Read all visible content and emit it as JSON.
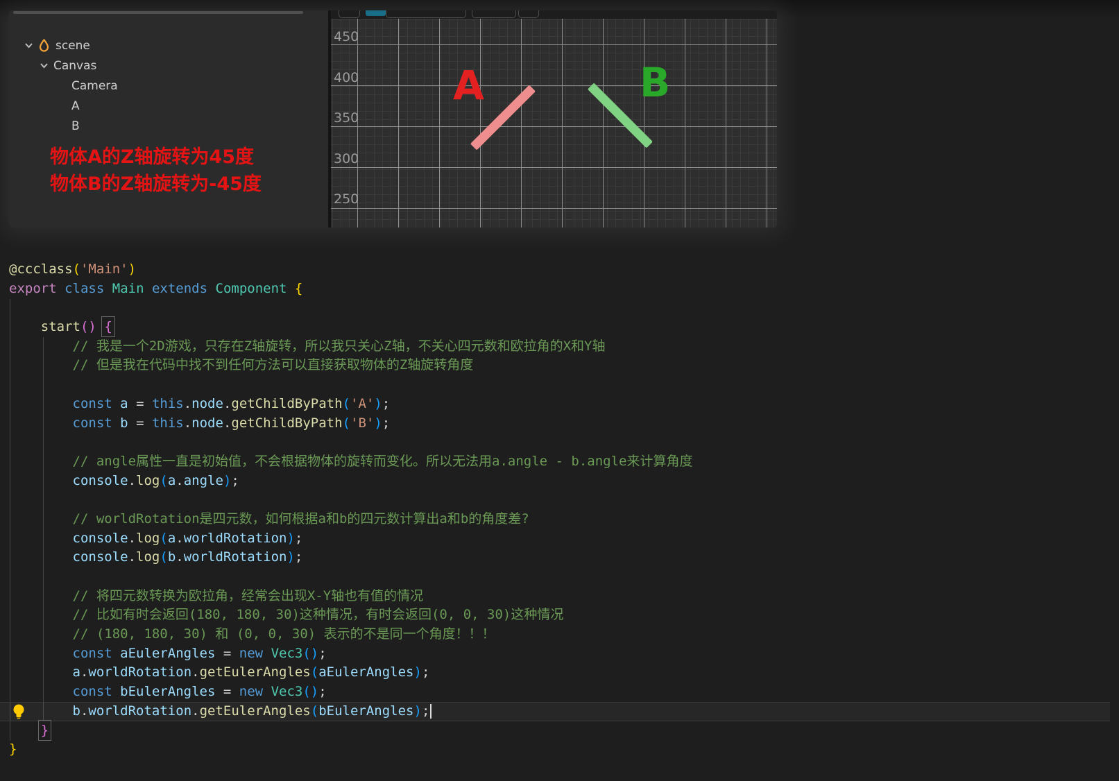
{
  "editor_screenshot": {
    "hierarchy": {
      "items": [
        {
          "label": "scene",
          "icon": "cocos-drop-icon",
          "expanded": true
        },
        {
          "label": "Canvas",
          "expanded": true
        },
        {
          "label": "Camera"
        },
        {
          "label": "A"
        },
        {
          "label": "B"
        }
      ],
      "annotation": {
        "lines": [
          "物体A的Z轴旋转为45度",
          "物体B的Z轴旋转为-45度"
        ],
        "color": "#e41414"
      }
    },
    "scene_view": {
      "ruler_labels": [
        "450",
        "400",
        "350",
        "300",
        "250"
      ],
      "objects": [
        {
          "name": "A",
          "z_rotation_deg": 45,
          "label_color": "#e32121",
          "bar_color": "#ef8e8e"
        },
        {
          "name": "B",
          "z_rotation_deg": -45,
          "label_color": "#2aa82a",
          "bar_color": "#7fd382"
        }
      ]
    }
  },
  "code": {
    "syntax_colors": {
      "keyword": "#569cd6",
      "control": "#c586c0",
      "type": "#4ec9b0",
      "function": "#dcdcaa",
      "variable": "#9cdcfe",
      "string": "#ce9178",
      "comment": "#6a9955",
      "bracket1": "#ffd700",
      "bracket2": "#da70d6",
      "bracket3": "#179fff"
    },
    "lines": [
      {
        "tokens": [
          [
            "fn",
            "@ccclass"
          ],
          [
            "b1",
            "("
          ],
          [
            "str",
            "'Main'"
          ],
          [
            "b1",
            ")"
          ]
        ]
      },
      {
        "tokens": [
          [
            "ctl",
            "export"
          ],
          [
            "pun",
            " "
          ],
          [
            "kw",
            "class"
          ],
          [
            "pun",
            " "
          ],
          [
            "type",
            "Main"
          ],
          [
            "pun",
            " "
          ],
          [
            "kw",
            "extends"
          ],
          [
            "pun",
            " "
          ],
          [
            "type",
            "Component"
          ],
          [
            "pun",
            " "
          ],
          [
            "b1",
            "{"
          ]
        ]
      },
      {
        "tokens": []
      },
      {
        "tokens": [
          [
            "pun",
            "    "
          ],
          [
            "fn",
            "start"
          ],
          [
            "b2",
            "()"
          ],
          [
            "pun",
            " "
          ],
          [
            "b2 box",
            "{"
          ]
        ]
      },
      {
        "tokens": [
          [
            "cmt",
            "        // 我是一个2D游戏，只存在Z轴旋转，所以我只关心Z轴，不关心四元数和欧拉角的X和Y轴"
          ]
        ]
      },
      {
        "tokens": [
          [
            "cmt",
            "        // 但是我在代码中找不到任何方法可以直接获取物体的Z轴旋转角度"
          ]
        ]
      },
      {
        "tokens": []
      },
      {
        "tokens": [
          [
            "pun",
            "        "
          ],
          [
            "kw",
            "const"
          ],
          [
            "pun",
            " "
          ],
          [
            "var",
            "a"
          ],
          [
            "pun",
            " = "
          ],
          [
            "kw",
            "this"
          ],
          [
            "pun",
            "."
          ],
          [
            "var",
            "node"
          ],
          [
            "pun",
            "."
          ],
          [
            "fn",
            "getChildByPath"
          ],
          [
            "b3",
            "("
          ],
          [
            "str",
            "'A'"
          ],
          [
            "b3",
            ")"
          ],
          [
            "pun",
            ";"
          ]
        ]
      },
      {
        "tokens": [
          [
            "pun",
            "        "
          ],
          [
            "kw",
            "const"
          ],
          [
            "pun",
            " "
          ],
          [
            "var",
            "b"
          ],
          [
            "pun",
            " = "
          ],
          [
            "kw",
            "this"
          ],
          [
            "pun",
            "."
          ],
          [
            "var",
            "node"
          ],
          [
            "pun",
            "."
          ],
          [
            "fn",
            "getChildByPath"
          ],
          [
            "b3",
            "("
          ],
          [
            "str",
            "'B'"
          ],
          [
            "b3",
            ")"
          ],
          [
            "pun",
            ";"
          ]
        ]
      },
      {
        "tokens": []
      },
      {
        "tokens": [
          [
            "cmt",
            "        // angle属性一直是初始值，不会根据物体的旋转而变化。所以无法用a.angle - b.angle来计算角度"
          ]
        ]
      },
      {
        "tokens": [
          [
            "pun",
            "        "
          ],
          [
            "var",
            "console"
          ],
          [
            "pun",
            "."
          ],
          [
            "fn",
            "log"
          ],
          [
            "b3",
            "("
          ],
          [
            "var",
            "a"
          ],
          [
            "pun",
            "."
          ],
          [
            "var",
            "angle"
          ],
          [
            "b3",
            ")"
          ],
          [
            "pun",
            ";"
          ]
        ]
      },
      {
        "tokens": []
      },
      {
        "tokens": [
          [
            "cmt",
            "        // worldRotation是四元数，如何根据a和b的四元数计算出a和b的角度差?"
          ]
        ]
      },
      {
        "tokens": [
          [
            "pun",
            "        "
          ],
          [
            "var",
            "console"
          ],
          [
            "pun",
            "."
          ],
          [
            "fn",
            "log"
          ],
          [
            "b3",
            "("
          ],
          [
            "var",
            "a"
          ],
          [
            "pun",
            "."
          ],
          [
            "var",
            "worldRotation"
          ],
          [
            "b3",
            ")"
          ],
          [
            "pun",
            ";"
          ]
        ]
      },
      {
        "tokens": [
          [
            "pun",
            "        "
          ],
          [
            "var",
            "console"
          ],
          [
            "pun",
            "."
          ],
          [
            "fn",
            "log"
          ],
          [
            "b3",
            "("
          ],
          [
            "var",
            "b"
          ],
          [
            "pun",
            "."
          ],
          [
            "var",
            "worldRotation"
          ],
          [
            "b3",
            ")"
          ],
          [
            "pun",
            ";"
          ]
        ]
      },
      {
        "tokens": []
      },
      {
        "tokens": [
          [
            "cmt",
            "        // 将四元数转换为欧拉角，经常会出现X-Y轴也有值的情况"
          ]
        ]
      },
      {
        "tokens": [
          [
            "cmt",
            "        // 比如有时会返回(180, 180, 30)这种情况，有时会返回(0, 0, 30)这种情况"
          ]
        ]
      },
      {
        "tokens": [
          [
            "cmt",
            "        // (180, 180, 30) 和 (0, 0, 30) 表示的不是同一个角度！！！"
          ]
        ]
      },
      {
        "tokens": [
          [
            "pun",
            "        "
          ],
          [
            "kw",
            "const"
          ],
          [
            "pun",
            " "
          ],
          [
            "var",
            "aEulerAngles"
          ],
          [
            "pun",
            " = "
          ],
          [
            "kw",
            "new"
          ],
          [
            "pun",
            " "
          ],
          [
            "type",
            "Vec3"
          ],
          [
            "b3",
            "()"
          ],
          [
            "pun",
            ";"
          ]
        ]
      },
      {
        "tokens": [
          [
            "pun",
            "        "
          ],
          [
            "var",
            "a"
          ],
          [
            "pun",
            "."
          ],
          [
            "var",
            "worldRotation"
          ],
          [
            "pun",
            "."
          ],
          [
            "fn",
            "getEulerAngles"
          ],
          [
            "b3",
            "("
          ],
          [
            "var",
            "aEulerAngles"
          ],
          [
            "b3",
            ")"
          ],
          [
            "pun",
            ";"
          ]
        ]
      },
      {
        "tokens": [
          [
            "pun",
            "        "
          ],
          [
            "kw",
            "const"
          ],
          [
            "pun",
            " "
          ],
          [
            "var",
            "bEulerAngles"
          ],
          [
            "pun",
            " = "
          ],
          [
            "kw",
            "new"
          ],
          [
            "pun",
            " "
          ],
          [
            "type",
            "Vec3"
          ],
          [
            "b3",
            "()"
          ],
          [
            "pun",
            ";"
          ]
        ]
      },
      {
        "tokens": [
          [
            "pun",
            "        "
          ],
          [
            "var",
            "b"
          ],
          [
            "pun",
            "."
          ],
          [
            "var",
            "worldRotation"
          ],
          [
            "pun",
            "."
          ],
          [
            "fn",
            "getEulerAngles"
          ],
          [
            "b3",
            "("
          ],
          [
            "var",
            "bEulerAngles"
          ],
          [
            "b3",
            ")"
          ],
          [
            "pun",
            ";"
          ]
        ],
        "current": true,
        "cursor": true
      },
      {
        "tokens": [
          [
            "pun",
            "    "
          ],
          [
            "b2 box",
            "}"
          ]
        ]
      },
      {
        "tokens": [
          [
            "b1",
            "}"
          ]
        ]
      }
    ]
  }
}
